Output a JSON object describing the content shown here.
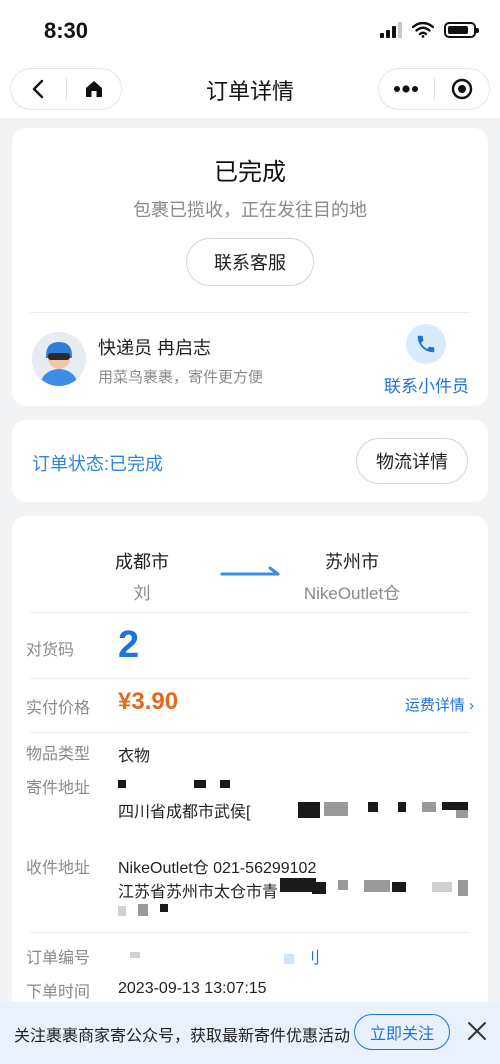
{
  "status_bar": {
    "time": "8:30"
  },
  "nav": {
    "title": "订单详情"
  },
  "status_card": {
    "title": "已完成",
    "subtitle": "包裹已揽收，正在发往目的地",
    "service_button": "联系客服",
    "courier_name": "快递员  冉启志",
    "courier_hint": "用菜鸟裹裹，寄件更方便",
    "contact_courier": "联系小件员"
  },
  "order_card": {
    "status_text": "订单状态:已完成",
    "logistics_button": "物流详情"
  },
  "detail_card": {
    "from_city": "成都市",
    "from_name": "刘",
    "to_city": "苏州市",
    "to_name": "NikeOutlet仓",
    "code_label": "对货码",
    "code_value": "2",
    "price_label": "实付价格",
    "price_value": "¥3.90",
    "fee_detail_link": "运费详情 ›",
    "type_label": "物品类型",
    "type_value": "衣物",
    "sender_label": "寄件地址",
    "sender_address": "四川省成都市武侯[",
    "receiver_label": "收件地址",
    "receiver_line1": "NikeOutlet仓  021-56299102",
    "receiver_line2": "江苏省苏州市太仓市青",
    "order_no_label": "订单编号",
    "order_no_tail": "刂",
    "order_time_label": "下单时间",
    "order_time_value": "2023-09-13 13:07:15"
  },
  "banner": {
    "text": "关注裹裹商家寄公众号，获取最新寄件优惠活动",
    "follow_button": "立即关注"
  },
  "colors": {
    "accent": "#1d74d9",
    "price": "#e36a1d",
    "status_link": "#2f86d8"
  }
}
